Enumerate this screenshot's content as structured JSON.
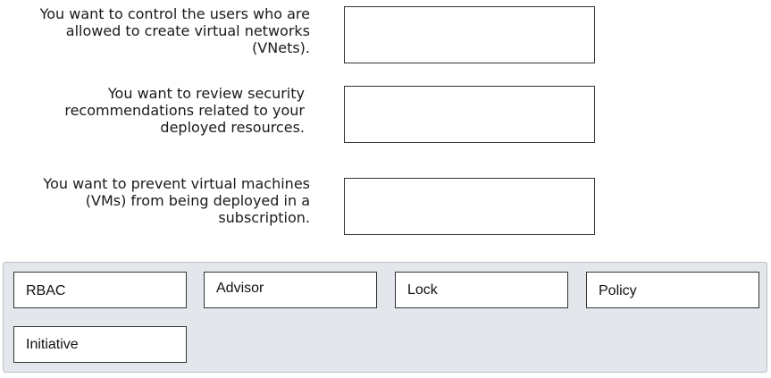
{
  "scenarios": [
    {
      "line1": "You want to control the users who are",
      "line2": "allowed to create virtual networks",
      "line3": "(VNets)."
    },
    {
      "line1": "You want to review security",
      "line2": "recommendations related to your",
      "line3": "deployed resources."
    },
    {
      "line1": "You want to prevent virtual machines",
      "line2": "(VMs) from being deployed in a",
      "line3": "subscription."
    }
  ],
  "options": [
    "RBAC",
    "Advisor",
    "Lock",
    "Policy",
    "Initiative"
  ]
}
